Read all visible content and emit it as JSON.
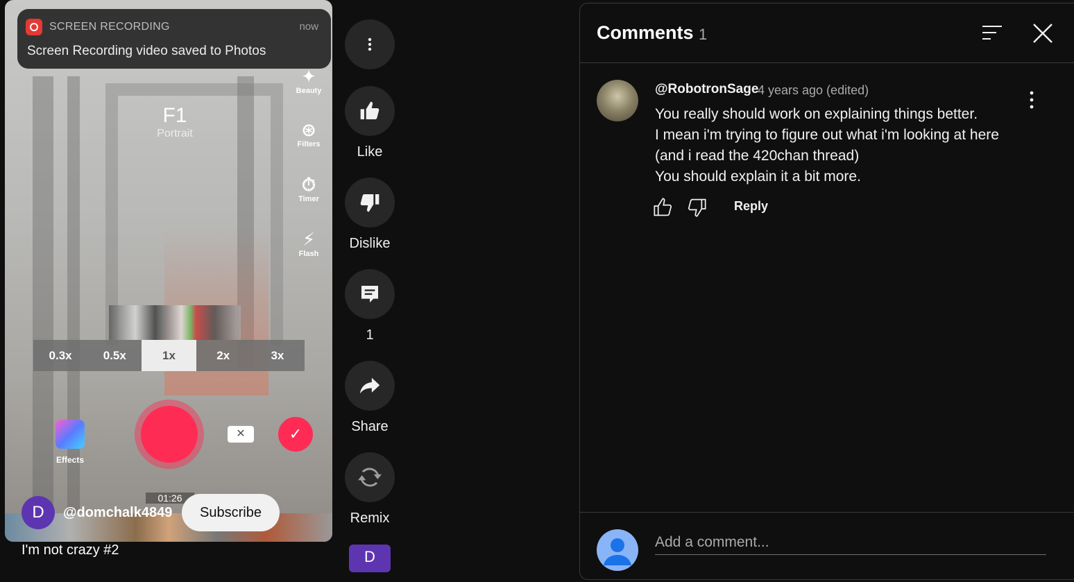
{
  "notification": {
    "app": "SCREEN RECORDING",
    "time": "now",
    "message": "Screen Recording video saved to Photos"
  },
  "camera": {
    "filter_name": "F1",
    "filter_style": "Portrait",
    "side_tools": [
      {
        "label": "Beauty",
        "icon": "beauty-wand-icon"
      },
      {
        "label": "Filters",
        "icon": "filters-icon"
      },
      {
        "label": "Timer",
        "icon": "timer-icon"
      },
      {
        "label": "Flash",
        "icon": "flash-off-icon"
      }
    ],
    "zoom_options": [
      "0.3x",
      "0.5x",
      "1x",
      "2x",
      "3x"
    ],
    "zoom_selected": "1x",
    "effects_label": "Effects",
    "timer_readout": "01:26"
  },
  "video": {
    "channel_initial": "D",
    "channel_name": "@domchalk4849",
    "subscribe_label": "Subscribe",
    "title": "I'm not crazy #2"
  },
  "actions": {
    "like_label": "Like",
    "dislike_label": "Dislike",
    "comment_count": "1",
    "share_label": "Share",
    "remix_label": "Remix",
    "bottom_avatar_initial": "D"
  },
  "comments_panel": {
    "title": "Comments",
    "count": "1",
    "comments": [
      {
        "author": "@RobotronSage",
        "meta": "4 years ago (edited)",
        "lines": [
          "You really should work on explaining things better.",
          "I mean i'm trying to figure out what i'm looking at here",
          "(and i read the 420chan thread)",
          "You should explain it a bit more."
        ],
        "reply_label": "Reply"
      }
    ],
    "add_comment_placeholder": "Add a comment..."
  },
  "colors": {
    "background": "#0f0f0f",
    "action_circle": "#272727",
    "record_red": "#fe2c55",
    "channel_avatar": "#5e35b1",
    "user_avatar": "#8ab4f8"
  }
}
